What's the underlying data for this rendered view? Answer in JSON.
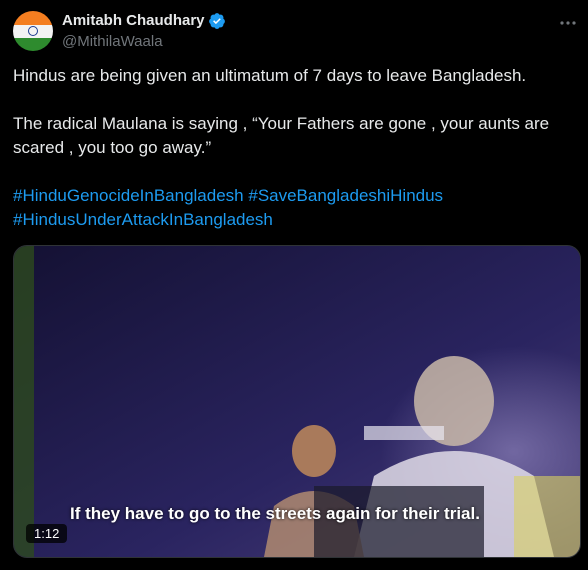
{
  "author": {
    "display_name": "Amitabh Chaudhary",
    "handle": "@MithilaWaala",
    "verified_icon": "verified-badge-icon",
    "avatar_icon": "indian-flag-avatar"
  },
  "post": {
    "line1": "Hindus are being given an ultimatum of 7 days to leave Bangladesh.",
    "line2": "The radical Maulana is saying , “Your Fathers are gone , your aunts are scared , you too go away.”",
    "hashtags": [
      "#HinduGenocideInBangladesh",
      "#SaveBangladeshiHindus",
      "#HindusUnderAttackInBangladesh"
    ]
  },
  "video": {
    "subtitle": "If they have to go to the streets again for their trial.",
    "duration": "1:12"
  },
  "colors": {
    "background": "#000000",
    "text": "#e7e9ea",
    "secondary": "#71767b",
    "link": "#1d9bf0",
    "verified": "#1d9bf0"
  }
}
